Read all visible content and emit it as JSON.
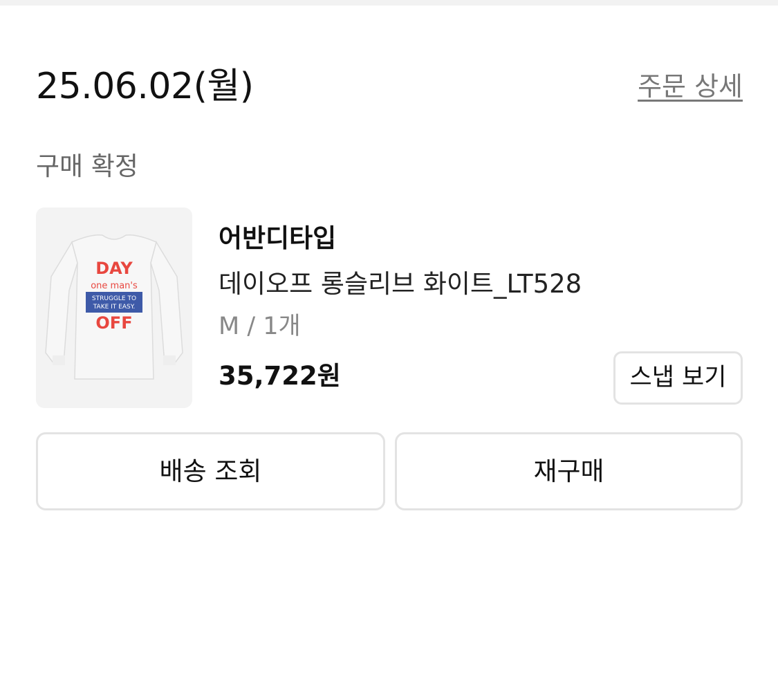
{
  "order": {
    "date": "25.06.02(월)",
    "detail_link": "주문 상세",
    "status": "구매 확정"
  },
  "product": {
    "brand": "어반디타입",
    "name": "데이오프 롱슬리브 화이트_LT528",
    "option": "M / 1개",
    "price": "35,722원",
    "image": {
      "icon": "long-sleeve-tshirt-image",
      "print_lines": [
        "DAY",
        "one man's",
        "STRUGGLE TO",
        "TAKE IT EASY.",
        "OFF"
      ],
      "colors": {
        "shirt": "#f7f7f7",
        "red": "#e8473f",
        "blue": "#3e5aa8"
      }
    }
  },
  "buttons": {
    "snap": "스냅 보기",
    "delivery": "배송 조회",
    "rebuy": "재구매"
  },
  "colors": {
    "text_primary": "#111111",
    "text_secondary": "#666666",
    "text_muted": "#888888",
    "border": "#e3e3e3"
  }
}
